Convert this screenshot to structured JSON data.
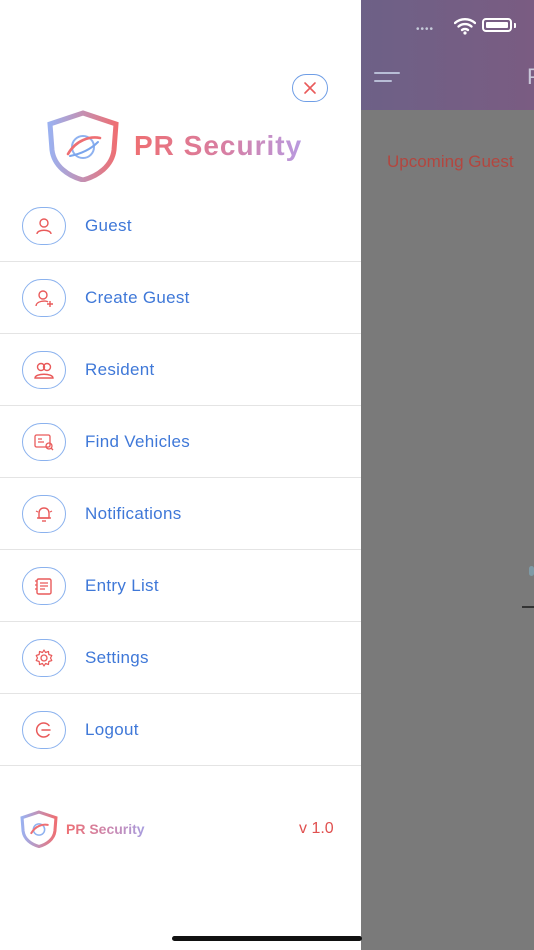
{
  "background": {
    "title_fragment": "P",
    "section_label": "Upcoming Guest"
  },
  "drawer": {
    "brand": "PR Security",
    "menu": [
      {
        "label": "Guest",
        "icon": "user-icon"
      },
      {
        "label": "Create Guest",
        "icon": "add-user-icon"
      },
      {
        "label": "Resident",
        "icon": "users-icon"
      },
      {
        "label": "Find Vehicles",
        "icon": "vehicle-search-icon"
      },
      {
        "label": "Notifications",
        "icon": "bell-icon"
      },
      {
        "label": "Entry List",
        "icon": "list-icon"
      },
      {
        "label": "Settings",
        "icon": "gear-icon"
      },
      {
        "label": "Logout",
        "icon": "logout-icon"
      }
    ],
    "footer": {
      "brand": "PR Security",
      "version": "v 1.0"
    }
  },
  "colors": {
    "accent_blue": "#3f78d8",
    "icon_red": "#e95a5a",
    "header_gradient_start": "#4f6aa3"
  }
}
